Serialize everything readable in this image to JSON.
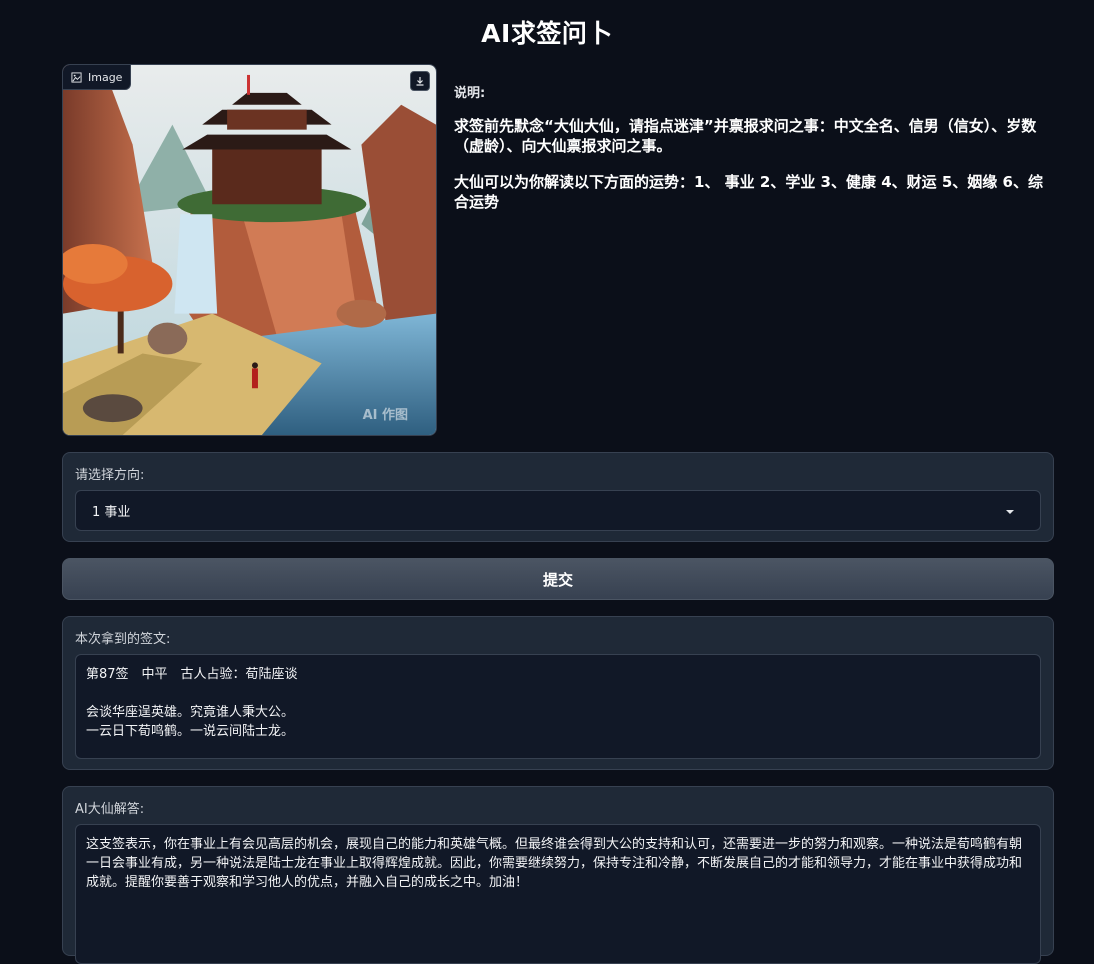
{
  "page_title": "AI求签问卜",
  "image_panel": {
    "badge_label": "Image",
    "watermark": "AI 作图"
  },
  "description": {
    "heading": "说明:",
    "paragraph1": "求签前先默念“大仙大仙，请指点迷津”并禀报求问之事：中文全名、信男（信女）、岁数（虚龄）、向大仙禀报求问之事。",
    "paragraph2": "大仙可以为你解读以下方面的运势：1、 事业 2、学业 3、健康 4、财运 5、姻缘 6、综合运势"
  },
  "direction": {
    "label": "请选择方向:",
    "selected": "1 事业"
  },
  "submit_label": "提交",
  "result": {
    "label": "本次拿到的签文:",
    "lines": [
      "第87签　中平　古人占验：荀陆座谈",
      "",
      "会谈华座逞英雄。究竟谁人秉大公。",
      "一云日下荀鸣鹤。一说云间陆士龙。"
    ]
  },
  "answer": {
    "label": "AI大仙解答:",
    "text": "这支签表示，你在事业上有会见高层的机会，展现自己的能力和英雄气概。但最终谁会得到大公的支持和认可，还需要进一步的努力和观察。一种说法是荀鸣鹤有朝一日会事业有成，另一种说法是陆士龙在事业上取得辉煌成就。因此，你需要继续努力，保持专注和冷静，不断发展自己的才能和领导力，才能在事业中获得成功和成就。提醒你要善于观察和学习他人的优点，并融入自己的成长之中。加油！"
  },
  "icons": {
    "image_badge": "image-icon",
    "download": "download-icon",
    "dropdown": "chevron-down-icon"
  }
}
